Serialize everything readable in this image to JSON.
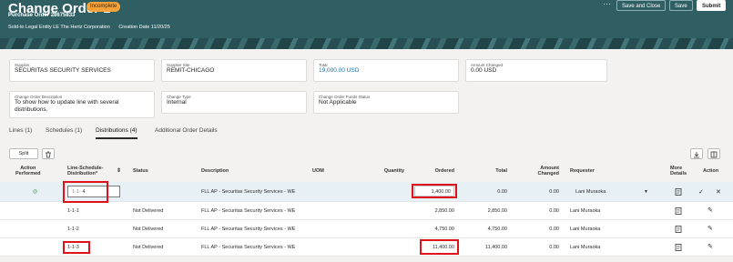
{
  "header": {
    "title": "Change Order 1",
    "badge": "Incomplete",
    "subtitle": "Purchase Order 28675833",
    "sold_to": "Sold-to Legal Entity LE The Hertz Corporation",
    "creation_date": "Creation Date 11/20/25",
    "more": "···",
    "save_and_close": "Save and Close",
    "save": "Save",
    "submit": "Submit"
  },
  "summary": {
    "supplier": {
      "label": "Supplier",
      "value": "SECURITAS SECURITY SERVICES"
    },
    "supplier_site": {
      "label": "Supplier Site",
      "value": "REMIT-CHICAGO"
    },
    "total": {
      "label": "Total",
      "value": "19,000.00 USD"
    },
    "amount_changed": {
      "label": "Amount Changed",
      "value": "0.00 USD"
    },
    "description": {
      "label": "Change Order Description",
      "value1": "To show how to update line with several",
      "value2": "distributions."
    },
    "change_type": {
      "label": "Change Type",
      "value": "Internal"
    },
    "funds_status": {
      "label": "Change Order Funds Status",
      "value": "Not Applicable"
    }
  },
  "tabs": [
    "Lines  (1)",
    "Schedules  (1)",
    "Distributions  (4)",
    "Additional Order Details"
  ],
  "toolbar": {
    "split": "Split"
  },
  "columns": {
    "action1": "Action",
    "action2": "Performed",
    "lsd1": "Line-Schedule-",
    "lsd2": "Distribution*",
    "status": "Status",
    "description": "Description",
    "uom": "UOM",
    "quantity": "Quantity",
    "ordered": "Ordered",
    "total": "Total",
    "amount1": "Amount",
    "amount2": "Changed",
    "requester": "Requester",
    "more1": "More",
    "more2": "Details",
    "action": "Action"
  },
  "rows": [
    {
      "lsd_prefix": "1-1-",
      "lsd_value": "4",
      "status": "",
      "description": "FLL AP - Securitas Security Services - WE",
      "ordered": "1,400.00",
      "total": "0.00",
      "amount_changed": "0.00",
      "requester": "Lani Muraoka"
    },
    {
      "lsd": "1-1-1",
      "status": "Not Delivered",
      "description": "FLL AP - Securitas Security Services - WE",
      "ordered": "2,850.00",
      "total": "2,850.00",
      "amount_changed": "0.00",
      "requester": "Lani Muraoka"
    },
    {
      "lsd": "1-1-2",
      "status": "Not Delivered",
      "description": "FLL AP - Securitas Security Services - WE",
      "ordered": "4,750.00",
      "total": "4,750.00",
      "amount_changed": "0.00",
      "requester": "Lani Muraoka"
    },
    {
      "lsd": "1-1-3",
      "status": "Not Delivered",
      "description": "FLL AP - Securitas Security Services - WE",
      "ordered": "11,400.00",
      "total": "11,400.00",
      "amount_changed": "0.00",
      "requester": "Lani Muraoka"
    }
  ]
}
